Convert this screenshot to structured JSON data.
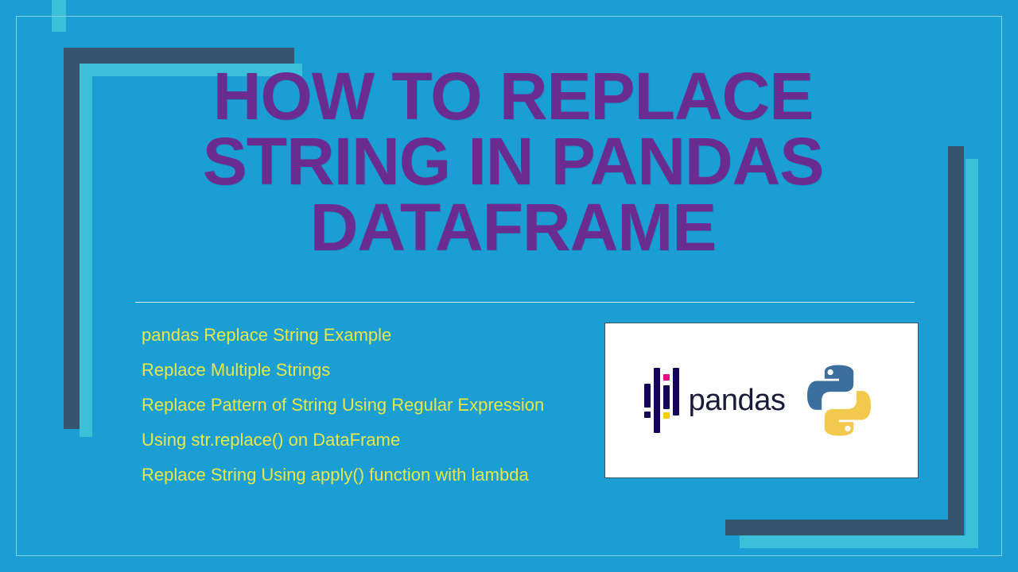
{
  "title": "HOW TO REPLACE STRING IN PANDAS DATAFRAME",
  "bullets": [
    "pandas Replace String Example",
    "Replace Multiple Strings",
    "Replace Pattern of String Using Regular Expression",
    " Using str.replace() on DataFrame",
    "Replace String Using apply() function with lambda"
  ],
  "logo": {
    "pandas_text": "pandas"
  },
  "colors": {
    "bg": "#1a9ed4",
    "title": "#6a2c91",
    "bullet": "#e8e84a",
    "dark_bracket": "#34556b",
    "cyan_bracket": "#3ac0d8"
  }
}
